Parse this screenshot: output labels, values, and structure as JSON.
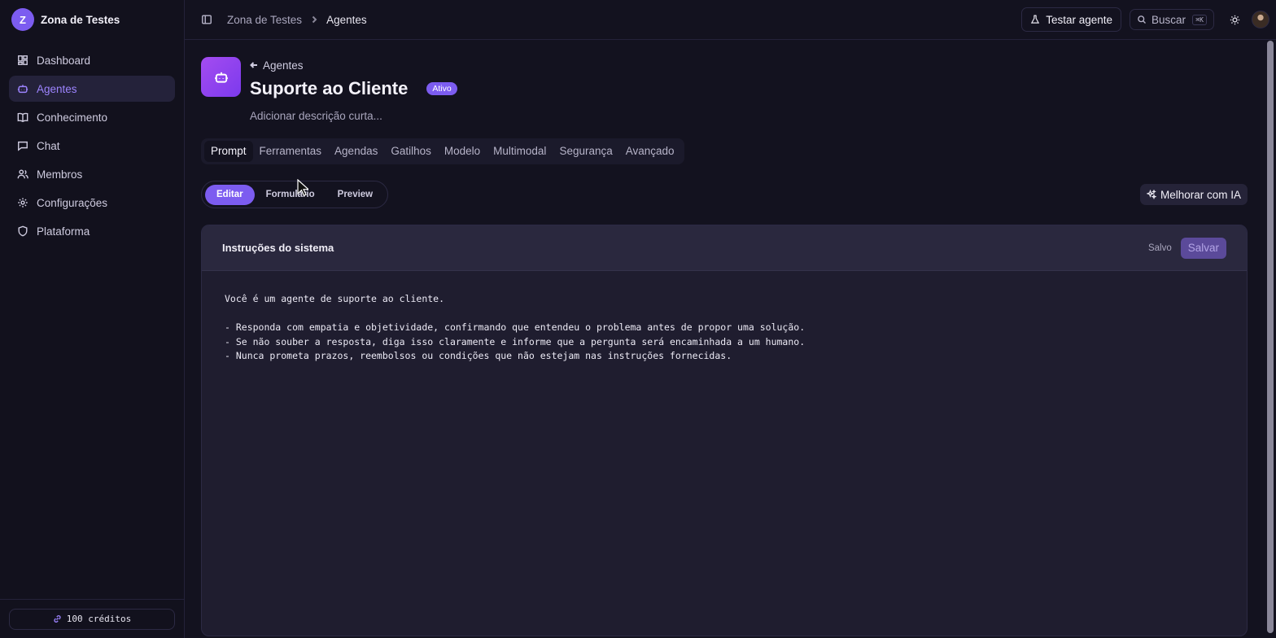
{
  "org": {
    "initial": "Z",
    "name": "Zona de Testes"
  },
  "sidebar": {
    "items": [
      {
        "label": "Dashboard",
        "icon": "dashboard-icon"
      },
      {
        "label": "Agentes",
        "icon": "bot-icon",
        "active": true
      },
      {
        "label": "Conhecimento",
        "icon": "book-icon"
      },
      {
        "label": "Chat",
        "icon": "chat-icon"
      },
      {
        "label": "Membros",
        "icon": "users-icon"
      },
      {
        "label": "Configurações",
        "icon": "gear-icon"
      },
      {
        "label": "Plataforma",
        "icon": "shield-icon"
      }
    ],
    "credits": "100 créditos"
  },
  "topbar": {
    "breadcrumb": [
      "Zona de Testes",
      "Agentes"
    ],
    "test_label": "Testar agente",
    "search_label": "Buscar",
    "search_shortcut": "⌘K"
  },
  "agent": {
    "back_label": "Agentes",
    "title": "Suporte ao Cliente",
    "status": "Ativo",
    "description_placeholder": "Adicionar descrição curta..."
  },
  "tabs": [
    "Prompt",
    "Ferramentas",
    "Agendas",
    "Gatilhos",
    "Modelo",
    "Multimodal",
    "Segurança",
    "Avançado"
  ],
  "active_tab": "Prompt",
  "modes": [
    "Editar",
    "Formulário",
    "Preview"
  ],
  "active_mode": "Editar",
  "improve_label": "Melhorar com IA",
  "editor": {
    "title": "Instruções do sistema",
    "saved_status": "Salvo",
    "save_label": "Salvar",
    "lines": [
      "Você é um agente de suporte ao cliente.",
      "",
      "- Responda com empatia e objetividade, confirmando que entendeu o problema antes de propor uma solução.",
      "- Se não souber a resposta, diga isso claramente e informe que a pergunta será encaminhada a um humano.",
      "- Nunca prometa prazos, reembolsos ou condições que não estejam nas instruções fornecidas."
    ]
  },
  "colors": {
    "accent": "#7c5cf0",
    "background": "#13121f",
    "panel": "#1f1d2f"
  }
}
